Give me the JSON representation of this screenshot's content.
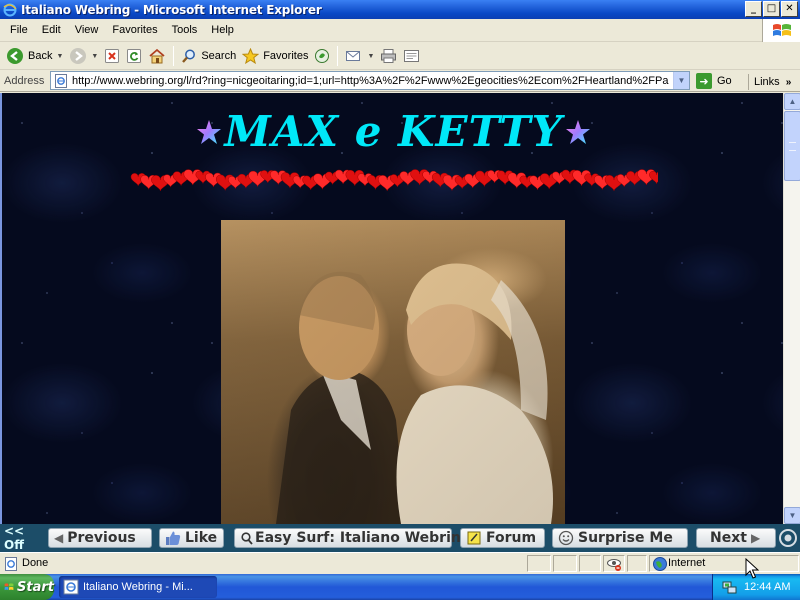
{
  "window": {
    "title": "Italiano Webring - Microsoft Internet Explorer",
    "buttons": {
      "minimize": "_",
      "maximize": "□",
      "close": "✕"
    }
  },
  "menu": [
    "File",
    "Edit",
    "View",
    "Favorites",
    "Tools",
    "Help"
  ],
  "toolbar": {
    "back": "Back",
    "search": "Search",
    "favorites": "Favorites"
  },
  "address": {
    "label": "Address",
    "url": "http://www.webring.org/l/rd?ring=nicgeoitaring;id=1;url=http%3A%2F%2Fwww%2Egeocities%2Ecom%2FHeartland%2FPa",
    "go": "Go",
    "links": "Links"
  },
  "page": {
    "heading": "MAX e KETTY",
    "heading_color": "#00e8f8",
    "photo_icon": "wedding-couple-photo"
  },
  "webring": {
    "off": "<< Off",
    "buttons": {
      "previous": "Previous",
      "like": "Like",
      "easysurf": "Easy Surf: Italiano Webring",
      "forum": "Forum",
      "surprise": "Surprise Me",
      "next": "Next"
    },
    "bar_color": "#1c4d68"
  },
  "status": {
    "text": "Done",
    "zone": "Internet"
  },
  "taskbar": {
    "start": "Start",
    "task": "Italiano Webring - Mi...",
    "clock": "12:44 AM"
  }
}
